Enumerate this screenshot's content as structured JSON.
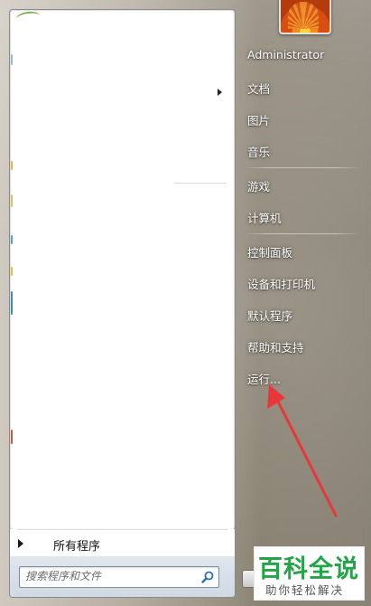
{
  "start_menu": {
    "user_name": "Administrator",
    "right_items": [
      {
        "label": "文档"
      },
      {
        "label": "图片"
      },
      {
        "label": "音乐"
      },
      {
        "label": "游戏"
      },
      {
        "label": "计算机"
      },
      {
        "label": "控制面板"
      },
      {
        "label": "设备和打印机"
      },
      {
        "label": "默认程序"
      },
      {
        "label": "帮助和支持"
      },
      {
        "label": "运行..."
      }
    ],
    "all_programs_label": "所有程序",
    "search_placeholder": "搜索程序和文件"
  },
  "watermark": {
    "title": "百科全说",
    "subtitle": "助你轻松解决"
  },
  "colors": {
    "annotation_arrow": "#e8373a",
    "watermark_green": "#22a447"
  },
  "icons": [
    "search-icon",
    "user-picture",
    "submenu-arrow-icon",
    "all-programs-arrow-icon"
  ]
}
